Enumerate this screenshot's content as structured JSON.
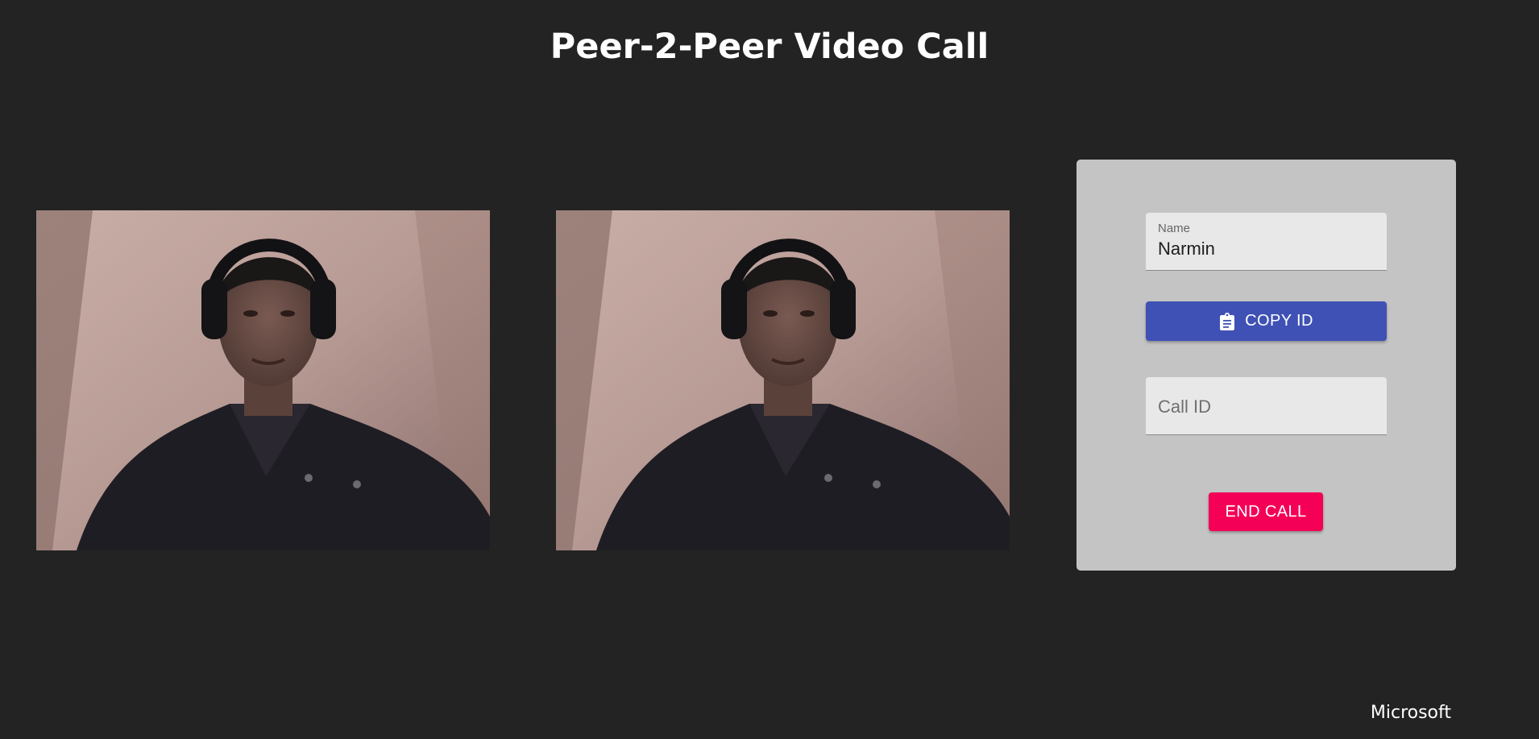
{
  "page": {
    "title": "Peer-2-Peer Video Call"
  },
  "videos": {
    "my_video": "camera-feed",
    "user_video": "camera-feed"
  },
  "form": {
    "name_label": "Name",
    "name_value": "Narmin",
    "copy_button_label": "COPY ID",
    "copy_icon": "clipboard-icon",
    "call_id_placeholder": "Call ID",
    "call_id_value": "",
    "end_call_label": "END CALL"
  },
  "footer": {
    "text": "Microsoft"
  },
  "colors": {
    "background": "#232323",
    "panel": "#c4c4c4",
    "primary": "#3f51b5",
    "secondary": "#f50057"
  }
}
